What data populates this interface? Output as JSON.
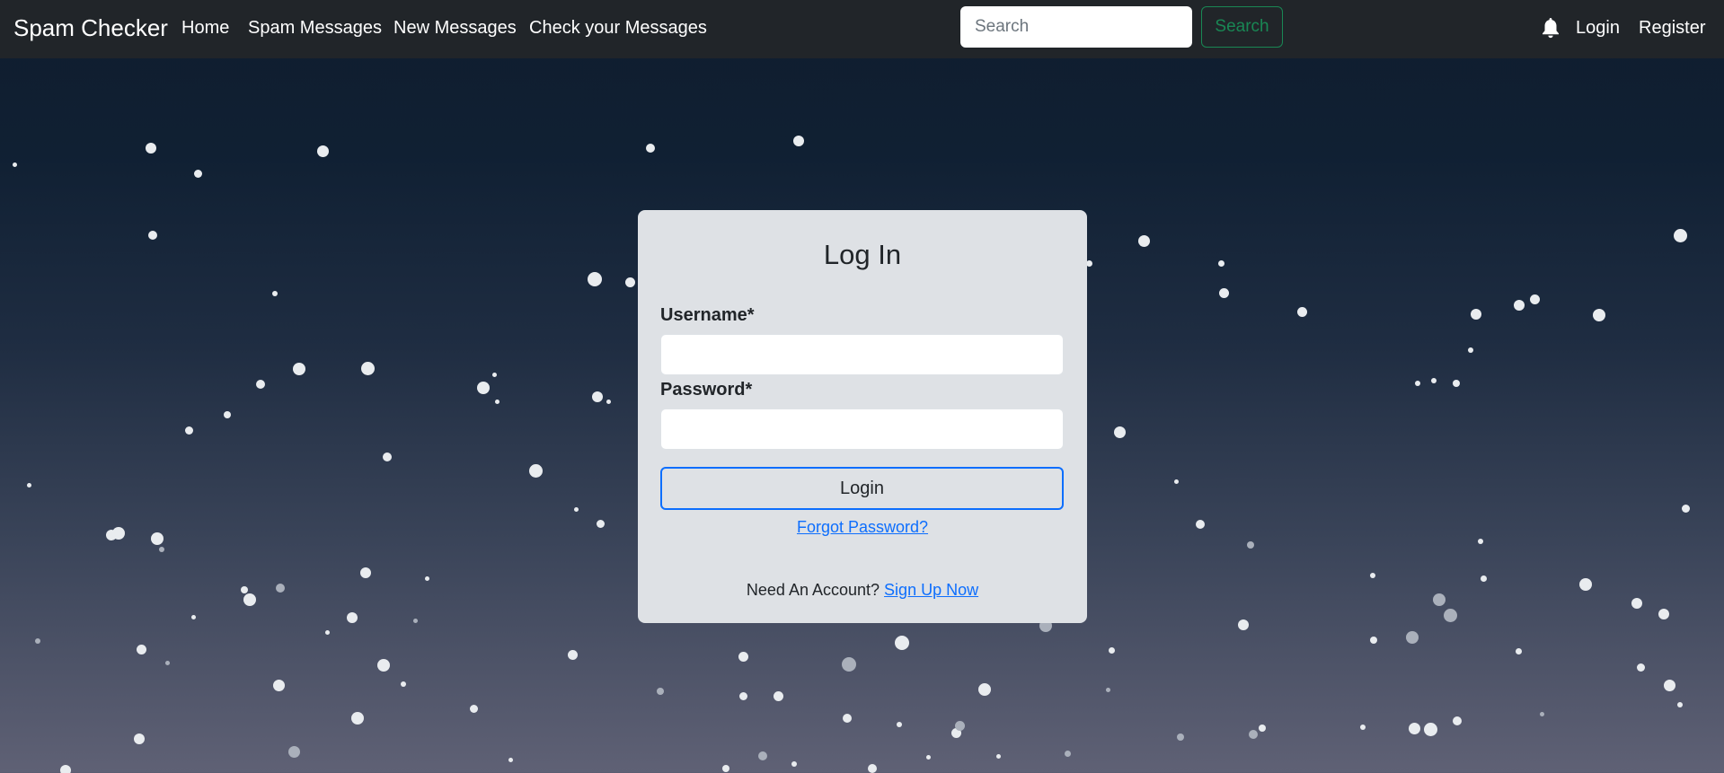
{
  "navbar": {
    "brand": "Spam Checker",
    "links": [
      "Home",
      "Spam Messages",
      "New Messages",
      "Check your Messages"
    ],
    "search_placeholder": "Search",
    "search_button": "Search",
    "bell_icon": "bell-icon",
    "right_links": [
      "Login",
      "Register"
    ]
  },
  "login_card": {
    "title": "Log In",
    "username_label": "Username*",
    "username_value": "",
    "password_label": "Password*",
    "password_value": "",
    "login_button": "Login",
    "forgot_password": "Forgot Password?",
    "signup_prompt": "Need An Account?",
    "signup_link": "Sign Up Now"
  },
  "colors": {
    "navbar_bg": "#212529",
    "search_button": "#198754",
    "link": "#0d6efd",
    "card_bg": "#dee1e5"
  }
}
